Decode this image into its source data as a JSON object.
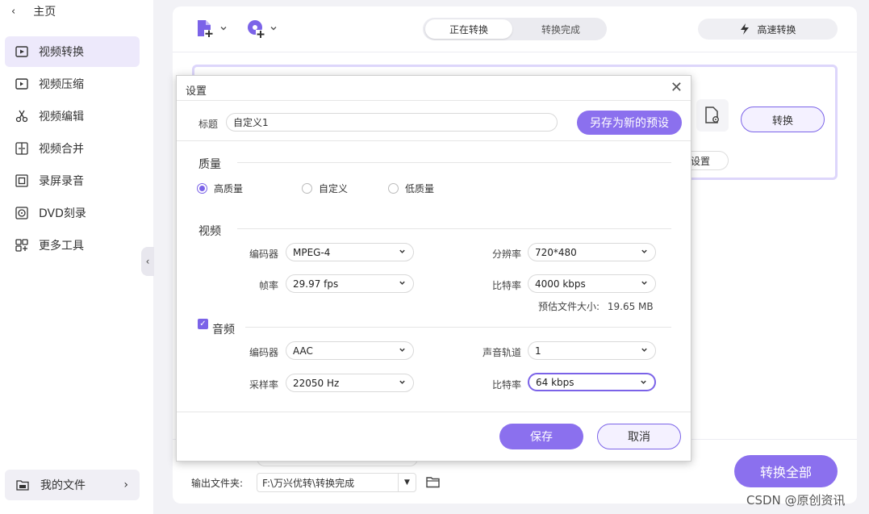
{
  "sidebar": {
    "home_label": "主页",
    "items": [
      {
        "label": "视频转换",
        "icon": "video-convert-icon",
        "active": true
      },
      {
        "label": "视频压缩",
        "icon": "video-compress-icon"
      },
      {
        "label": "视频编辑",
        "icon": "scissors-icon"
      },
      {
        "label": "视频合并",
        "icon": "merge-icon"
      },
      {
        "label": "录屏录音",
        "icon": "screen-record-icon"
      },
      {
        "label": "DVD刻录",
        "icon": "dvd-icon"
      },
      {
        "label": "更多工具",
        "icon": "grid-icon"
      }
    ],
    "my_files_label": "我的文件"
  },
  "toolbar": {
    "tab_converting": "正在转换",
    "tab_done": "转换完成",
    "fast_convert": "高速转换"
  },
  "card": {
    "convert_label": "转换",
    "settings_label": "设置"
  },
  "bottom": {
    "output_label": "输出文件夹:",
    "output_path": "F:\\万兴优转\\转换完成",
    "convert_all": "转换全部"
  },
  "dialog": {
    "title": "设置",
    "name_label": "标题",
    "name_value": "自定义1",
    "save_as_preset": "另存为新的预设",
    "quality_section": "质量",
    "quality_options": [
      "高质量",
      "自定义",
      "低质量"
    ],
    "quality_selected": "高质量",
    "video_section": "视频",
    "video": {
      "encoder_label": "编码器",
      "encoder_value": "MPEG-4",
      "resolution_label": "分辨率",
      "resolution_value": "720*480",
      "framerate_label": "帧率",
      "framerate_value": "29.97 fps",
      "bitrate_label": "比特率",
      "bitrate_value": "4000 kbps",
      "est_size_label": "预估文件大小:",
      "est_size_value": "19.65 MB"
    },
    "audio_section": "音频",
    "audio_checked": true,
    "audio": {
      "encoder_label": "编码器",
      "encoder_value": "AAC",
      "channel_label": "声音轨道",
      "channel_value": "1",
      "samplerate_label": "采样率",
      "samplerate_value": "22050 Hz",
      "bitrate_label": "比特率",
      "bitrate_value": "64 kbps"
    },
    "save_label": "保存",
    "cancel_label": "取消"
  },
  "watermark": "CSDN @原创资讯",
  "colors": {
    "accent": "#8b70ee",
    "accent_border": "#7b63e8",
    "active_nav_bg": "#ede9fb"
  }
}
